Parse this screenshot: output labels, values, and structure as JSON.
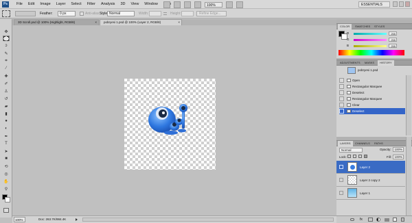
{
  "menubar": {
    "logo": "Ps",
    "items": [
      "File",
      "Edit",
      "Image",
      "Layer",
      "Select",
      "Filter",
      "Analysis",
      "3D",
      "View",
      "Window",
      "Help"
    ],
    "zoom": "100%",
    "workspace": "ESSENTIALS"
  },
  "options": {
    "feather_label": "Feather:",
    "feather_value": "0 px",
    "antialias_label": "Anti-alias",
    "style_label": "Style:",
    "style_value": "Normal",
    "width_label": "Width:",
    "height_label": "Height:",
    "refine_edge": "Refine Edge..."
  },
  "tabs": [
    {
      "label": "3D Scroll.psd @ 100% (Highlight, RGB/8)",
      "close": "×"
    },
    {
      "label": "pobryesi 1.psd @ 100% (Layer 2, RGB/8)",
      "close": "×"
    }
  ],
  "status": {
    "zoom": "100%",
    "doc": "Doc: 263.7K/984.4K"
  },
  "color_panel": {
    "tabs": [
      "COLOR",
      "SWATCHES",
      "STYLES"
    ],
    "channels": [
      {
        "label": "R",
        "value": "255",
        "color": "#00b0b0"
      },
      {
        "label": "G",
        "value": "255",
        "color": "#d000d0"
      },
      {
        "label": "B",
        "value": "255",
        "color": "#c0c000"
      }
    ]
  },
  "history_panel": {
    "tabs": [
      "ADJUSTMENTS",
      "MASKS",
      "HISTORY"
    ],
    "snapshot": "pobryesi 1.psd",
    "items": [
      "Open",
      "Rectangular Marquee",
      "Deselect",
      "Rectangular Marquee",
      "Clear",
      "Deselect"
    ],
    "selected_index": 5
  },
  "layers_panel": {
    "tabs": [
      "LAYERS",
      "CHANNELS",
      "PATHS"
    ],
    "blend_mode": "Normal",
    "opacity_label": "Opacity:",
    "opacity_value": "100%",
    "lock_label": "Lock:",
    "fill_label": "Fill:",
    "fill_value": "100%",
    "layers": [
      {
        "name": "Layer 2",
        "selected": true,
        "visible": true
      },
      {
        "name": "Layer 2 copy 2",
        "selected": false,
        "visible": false
      },
      {
        "name": "Layer 1",
        "selected": false,
        "visible": false
      }
    ]
  },
  "colors": {
    "ui_accent": "#3a6bc4",
    "selection": "#3465c8"
  }
}
